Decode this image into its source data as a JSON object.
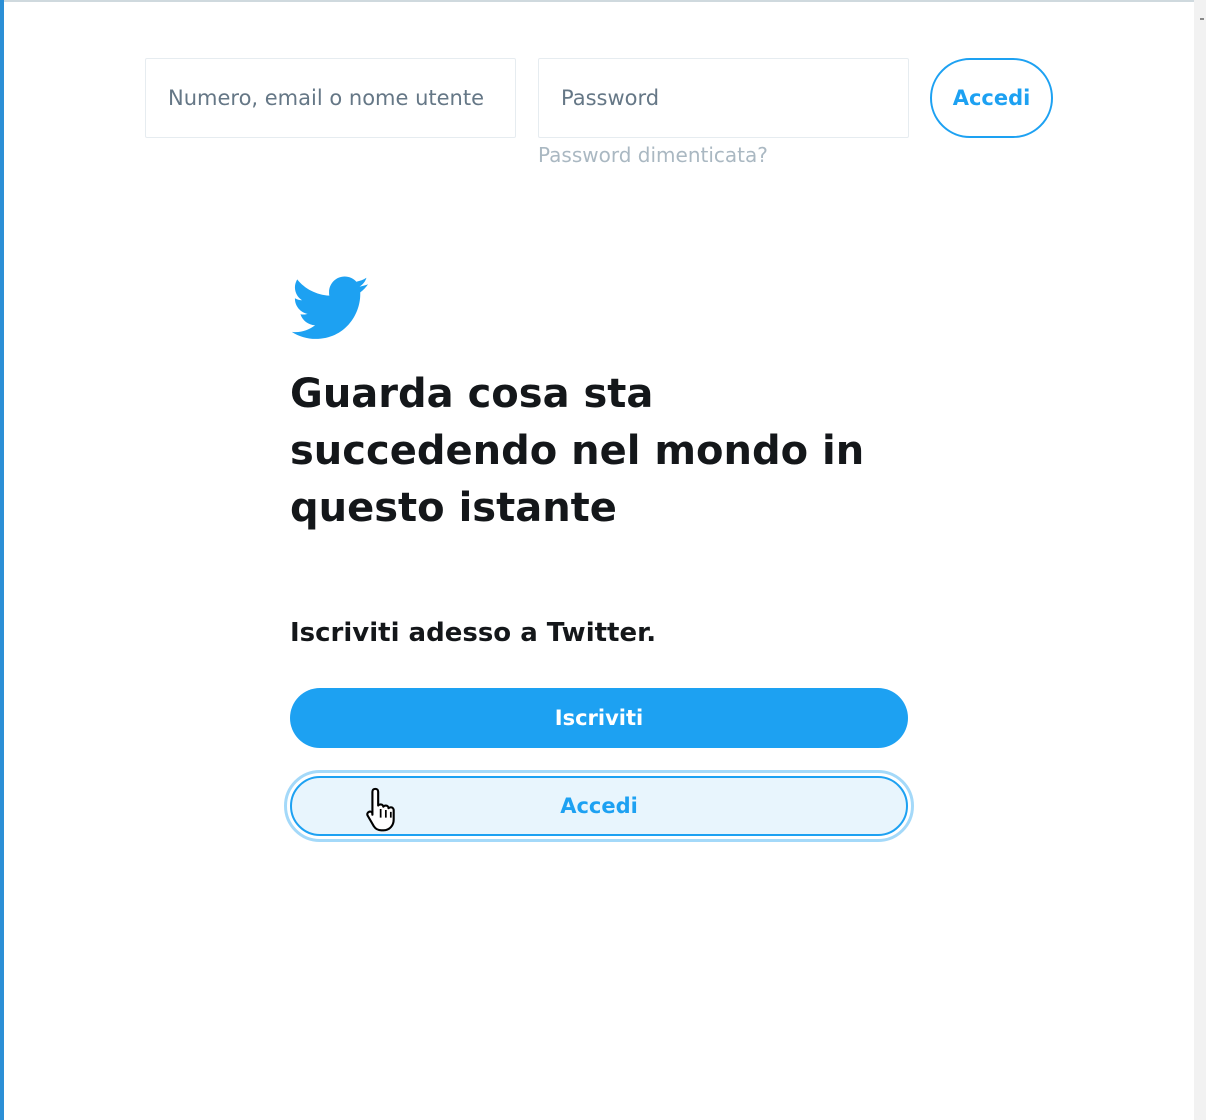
{
  "header": {
    "username_placeholder": "Numero, email o nome utente",
    "password_placeholder": "Password",
    "login_label": "Accedi",
    "forgot_password": "Password dimenticata?"
  },
  "main": {
    "logo_icon": "twitter-bird-icon",
    "headline": "Guarda cosa sta succedendo nel mondo in questo istante",
    "subheadline": "Iscriviti adesso a Twitter.",
    "signup_label": "Iscriviti",
    "login_label": "Accedi"
  },
  "colors": {
    "brand_blue": "#1da1f2",
    "text_dark": "#14171a",
    "text_muted": "#657786",
    "link_muted": "#aab8c2"
  },
  "cursor": "hand-pointer-icon"
}
